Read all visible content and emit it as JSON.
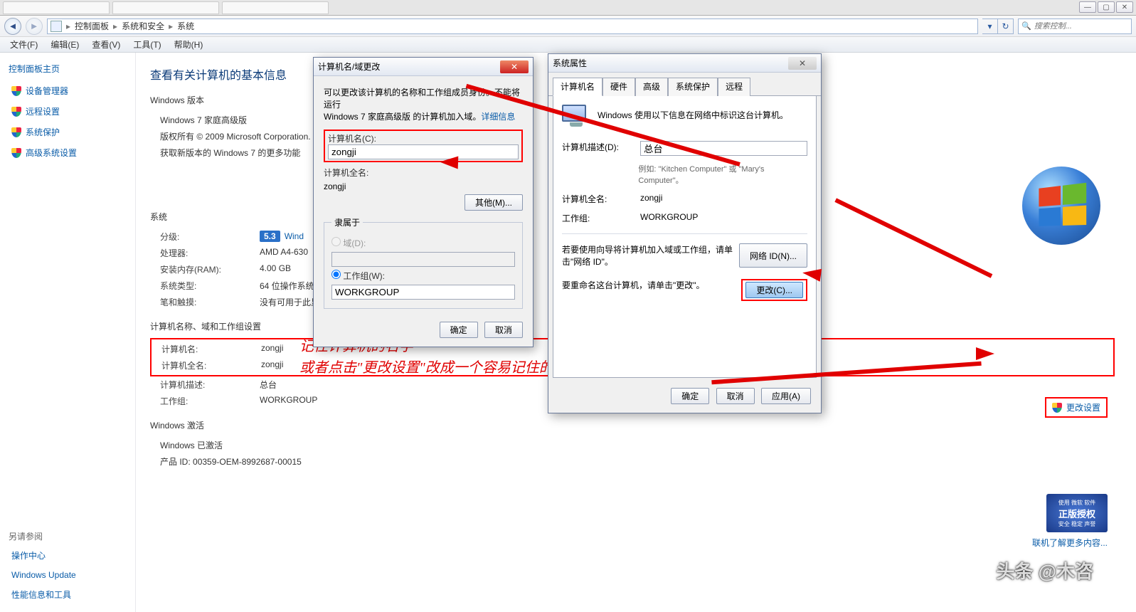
{
  "window": {
    "min": "—",
    "max": "▢",
    "close": "✕"
  },
  "breadcrumbs": {
    "root": "控制面板",
    "lvl1": "系统和安全",
    "lvl2": "系统"
  },
  "search": {
    "placeholder": "搜索控制..."
  },
  "menu": {
    "file": "文件(F)",
    "edit": "编辑(E)",
    "view": "查看(V)",
    "tool": "工具(T)",
    "help": "帮助(H)"
  },
  "sidebar": {
    "home": "控制面板主页",
    "devmgr": "设备管理器",
    "remote": "远程设置",
    "sysprot": "系统保护",
    "advsys": "高级系统设置",
    "also": "另请参阅",
    "action": "操作中心",
    "wu": "Windows Update",
    "perf": "性能信息和工具"
  },
  "main": {
    "title": "查看有关计算机的基本信息",
    "winver_hdr": "Windows 版本",
    "winver": "Windows 7 家庭高级版",
    "copyright": "版权所有 © 2009 Microsoft Corporation.",
    "more7": "获取新版本的 Windows 7 的更多功能",
    "sys_hdr": "系统",
    "rating_lbl": "分级:",
    "rating_val": "5.3",
    "rating_txt": "Wind",
    "cpu_lbl": "处理器:",
    "cpu_val": "AMD A4-630",
    "ram_lbl": "安装内存(RAM):",
    "ram_val": "4.00 GB",
    "type_lbl": "系统类型:",
    "type_val": "64 位操作系统",
    "pen_lbl": "笔和触摸:",
    "pen_val": "没有可用于此显示器的笔或触控输入",
    "dom_hdr": "计算机名称、域和工作组设置",
    "cname_lbl": "计算机名:",
    "cname_val": "zongji",
    "cfull_lbl": "计算机全名:",
    "cfull_val": "zongji",
    "cdesc_lbl": "计算机描述:",
    "cdesc_val": "总台",
    "wg_lbl": "工作组:",
    "wg_val": "WORKGROUP",
    "act_hdr": "Windows 激活",
    "act_stat": "Windows 已激活",
    "pid_lbl": "产品 ID: ",
    "pid_val": "00359-OEM-8992687-00015",
    "change_settings": "更改设置",
    "genuine1": "使用 微软 软件",
    "genuine2": "正版授权",
    "genuine3": "安全 稳定 声誉",
    "learn_more": "联机了解更多内容..."
  },
  "dlg1": {
    "title": "计算机名/域更改",
    "desc1": "可以更改该计算机的名称和工作组成员身份。不能将运行",
    "desc2": "Windows 7 家庭高级版 的计算机加入域。",
    "desc_link": "详细信息",
    "cname_lbl": "计算机名(C):",
    "cname_val": "zongji",
    "cfull_lbl": "计算机全名:",
    "cfull_val": "zongji",
    "other_btn": "其他(M)...",
    "member_hdr": "隶属于",
    "domain_rb": "域(D):",
    "wg_rb": "工作组(W):",
    "wg_val": "WORKGROUP",
    "ok": "确定",
    "cancel": "取消"
  },
  "dlg2": {
    "title": "系统属性",
    "tabs": {
      "cname": "计算机名",
      "hw": "硬件",
      "adv": "高级",
      "prot": "系统保护",
      "remote": "远程"
    },
    "intro": "Windows 使用以下信息在网络中标识这台计算机。",
    "cdesc_lbl": "计算机描述(D):",
    "cdesc_val": "总台",
    "example": "例如: \"Kitchen Computer\" 或 \"Mary's Computer\"。",
    "cfull_lbl": "计算机全名:",
    "cfull_val": "zongji",
    "wg_lbl": "工作组:",
    "wg_val": "WORKGROUP",
    "netid_txt": "若要使用向导将计算机加入域或工作组，请单击\"网络 ID\"。",
    "netid_btn": "网络 ID(N)...",
    "rename_txt": "要重命名这台计算机，请单击\"更改\"。",
    "rename_btn": "更改(C)...",
    "ok": "确定",
    "cancel": "取消",
    "apply": "应用(A)"
  },
  "anno": {
    "l1": "记住计算机的名字",
    "l2": "或者点击\"更改设置\"改成一个容易记住的计算机的名字"
  },
  "wm": "头条 @木咨"
}
